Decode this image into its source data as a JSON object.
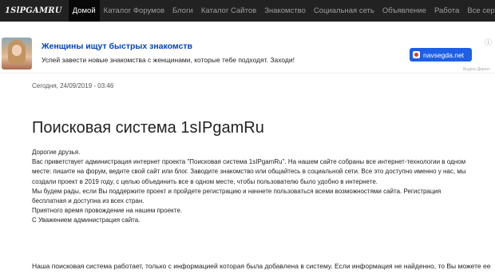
{
  "nav": {
    "brand": "1SlPGAMRU",
    "items": [
      "Домой",
      "Каталог Форумов",
      "Блоги",
      "Каталог Сайтов",
      "Знакомство",
      "Социальная сеть",
      "Объявление",
      "Работа",
      "Все сервисы"
    ],
    "active_index": 0
  },
  "ad": {
    "title": "Женщины ищут быстрых знакомств",
    "text": "Успей завести новые знакомства с женщинами, которые тебе подходят. Заходи!",
    "button_label": "navsegda.net",
    "info_icon": "ⓘ",
    "label": "Яндекс.Директ"
  },
  "content": {
    "date": "Сегодня, 24/09/2019 - 03:46",
    "heading": "Поисковая система 1sIPgamRu",
    "paragraphs": [
      "Дорогие друзья.",
      "Вас приветствует администрация интернет проекта \"Поисковая система 1sIPgamRu\". На нашем сайте собраны все интернет-технологии в одном",
      "месте: пишите на форум, ведите свой сайт или блог. Заводите знакомство или общайтесь в социальной сети. Все это доступно именно у нас, мы",
      "создали проект в 2019 году, с целью объединить все в одном месте, чтобы пользователю было удобно в интернете.",
      "Мы будем рады, если Вы поддержите проект и пройдете регистрацию и начнете пользоваться всеми возможностями сайта. Регистрация",
      "бесплатная и доступна из всех стран.",
      "Приятного время провождение на нашем проекте.",
      "С Уважением администрация сайта."
    ],
    "footer": "Наша поисковая система работает, только с информацией которая была добавлена в систему. Если информация не найденно, то Вы можете ее"
  },
  "colors": {
    "navbar": "#222222",
    "ad_title": "#0044bb",
    "ad_button": "#1e5fe6"
  }
}
